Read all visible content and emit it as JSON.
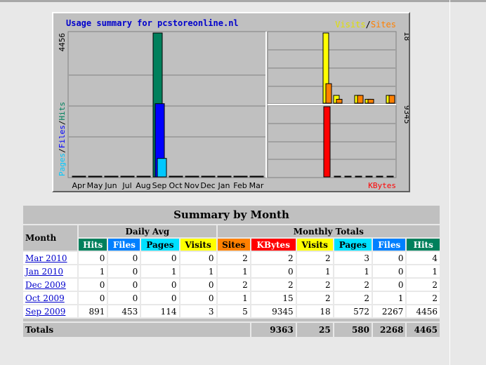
{
  "graph": {
    "title": "Usage summary for pcstoreonline.nl",
    "legend_visits": "Visits",
    "legend_sep": "/",
    "legend_sites": "Sites",
    "legend_kbytes": "KBytes",
    "left_max_label": "4456",
    "left_axis_pages": "Pages",
    "left_axis_files": "Files",
    "left_axis_hits": "Hits",
    "right_top_max_label": "18",
    "right_bottom_max_label": "9345"
  },
  "chart_data": {
    "type": "bar",
    "title": "Usage summary for pcstoreonline.nl",
    "categories": [
      "Apr",
      "May",
      "Jun",
      "Jul",
      "Aug",
      "Sep",
      "Oct",
      "Nov",
      "Dec",
      "Jan",
      "Feb",
      "Mar"
    ],
    "ylim_hits": [
      0,
      4456
    ],
    "ylim_visits": [
      0,
      18
    ],
    "ylim_kbytes": [
      0,
      9345
    ],
    "series": [
      {
        "name": "Hits",
        "values": [
          0,
          0,
          0,
          0,
          0,
          4456,
          2,
          0,
          2,
          1,
          0,
          4
        ]
      },
      {
        "name": "Files",
        "values": [
          0,
          0,
          0,
          0,
          0,
          2267,
          1,
          0,
          0,
          0,
          0,
          0
        ]
      },
      {
        "name": "Pages",
        "values": [
          0,
          0,
          0,
          0,
          0,
          572,
          2,
          0,
          2,
          1,
          0,
          3
        ]
      },
      {
        "name": "Visits",
        "values": [
          0,
          0,
          0,
          0,
          0,
          18,
          2,
          0,
          2,
          1,
          0,
          2
        ]
      },
      {
        "name": "Sites",
        "values": [
          0,
          0,
          0,
          0,
          0,
          5,
          1,
          0,
          2,
          1,
          0,
          2
        ]
      },
      {
        "name": "KBytes",
        "values": [
          0,
          0,
          0,
          0,
          0,
          9345,
          15,
          0,
          2,
          0,
          0,
          2
        ]
      }
    ],
    "colors": {
      "hits": "#00805c",
      "files": "#0000ff",
      "pages": "#00c8ff",
      "visits": "#ffff00",
      "sites": "#ff8000",
      "kbytes": "#ff0000"
    }
  },
  "summary": {
    "title": "Summary by Month",
    "col_month": "Month",
    "group_daily": "Daily Avg",
    "group_monthly": "Monthly Totals",
    "daily_cols": [
      "Hits",
      "Files",
      "Pages",
      "Visits"
    ],
    "monthly_cols": [
      "Sites",
      "KBytes",
      "Visits",
      "Pages",
      "Files",
      "Hits"
    ],
    "rows": [
      {
        "month": "Mar 2010",
        "d_hits": "0",
        "d_files": "0",
        "d_pages": "0",
        "d_visits": "0",
        "sites": "2",
        "kbytes": "2",
        "visits": "2",
        "pages": "3",
        "files": "0",
        "hits": "4"
      },
      {
        "month": "Jan 2010",
        "d_hits": "1",
        "d_files": "0",
        "d_pages": "1",
        "d_visits": "1",
        "sites": "1",
        "kbytes": "0",
        "visits": "1",
        "pages": "1",
        "files": "0",
        "hits": "1"
      },
      {
        "month": "Dec 2009",
        "d_hits": "0",
        "d_files": "0",
        "d_pages": "0",
        "d_visits": "0",
        "sites": "2",
        "kbytes": "2",
        "visits": "2",
        "pages": "2",
        "files": "0",
        "hits": "2"
      },
      {
        "month": "Oct 2009",
        "d_hits": "0",
        "d_files": "0",
        "d_pages": "0",
        "d_visits": "0",
        "sites": "1",
        "kbytes": "15",
        "visits": "2",
        "pages": "2",
        "files": "1",
        "hits": "2"
      },
      {
        "month": "Sep 2009",
        "d_hits": "891",
        "d_files": "453",
        "d_pages": "114",
        "d_visits": "3",
        "sites": "5",
        "kbytes": "9345",
        "visits": "18",
        "pages": "572",
        "files": "2267",
        "hits": "4456"
      }
    ],
    "totals_label": "Totals",
    "totals": {
      "kbytes": "9363",
      "visits": "25",
      "pages": "580",
      "files": "2268",
      "hits": "4465"
    }
  }
}
